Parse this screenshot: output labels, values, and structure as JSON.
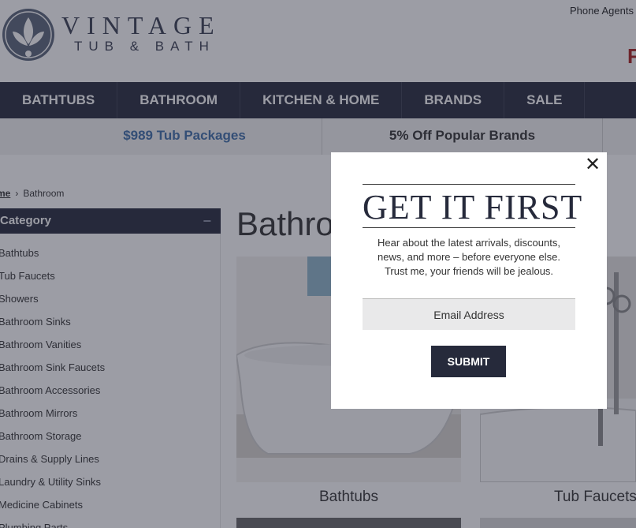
{
  "header": {
    "logo_line_1": "VINTAGE",
    "logo_line_2": "TUB & BATH",
    "phone_agents": "Phone Agents A",
    "promo_letter": "F"
  },
  "nav": {
    "items": [
      {
        "label": "BATHTUBS"
      },
      {
        "label": "BATHROOM"
      },
      {
        "label": "KITCHEN & HOME"
      },
      {
        "label": "BRANDS"
      },
      {
        "label": "SALE"
      }
    ]
  },
  "promos": [
    {
      "label": "$989 Tub Packages"
    },
    {
      "label": "5% Off Popular Brands"
    }
  ],
  "breadcrumb": {
    "home": "me",
    "separator": "›",
    "current": "Bathroom"
  },
  "sidebar": {
    "heading": "Category",
    "toggle": "−",
    "items": [
      {
        "label": "Bathtubs"
      },
      {
        "label": "Tub Faucets"
      },
      {
        "label": "Showers"
      },
      {
        "label": "Bathroom Sinks"
      },
      {
        "label": "Bathroom Vanities"
      },
      {
        "label": "Bathroom Sink Faucets"
      },
      {
        "label": "Bathroom Accessories"
      },
      {
        "label": "Bathroom Mirrors"
      },
      {
        "label": "Bathroom Storage"
      },
      {
        "label": "Drains & Supply Lines"
      },
      {
        "label": "Laundry & Utility Sinks"
      },
      {
        "label": "Medicine Cabinets"
      },
      {
        "label": "Plumbing Parts"
      }
    ]
  },
  "main": {
    "title": "Bathro",
    "products": [
      {
        "label": "Bathtubs"
      },
      {
        "label": "Tub Faucets"
      }
    ]
  },
  "modal": {
    "title": "GET IT FIRST",
    "text_line_1": "Hear about the latest arrivals, discounts,",
    "text_line_2": "news, and more – before everyone else.",
    "text_line_3": "Trust me, your friends will be jealous.",
    "email_placeholder": "Email Address",
    "submit_label": "SUBMIT",
    "close_glyph": "✕"
  },
  "colors": {
    "navy": "#262a3b",
    "promo_blue": "#3e6ea8",
    "promo_red": "#a8201f"
  }
}
